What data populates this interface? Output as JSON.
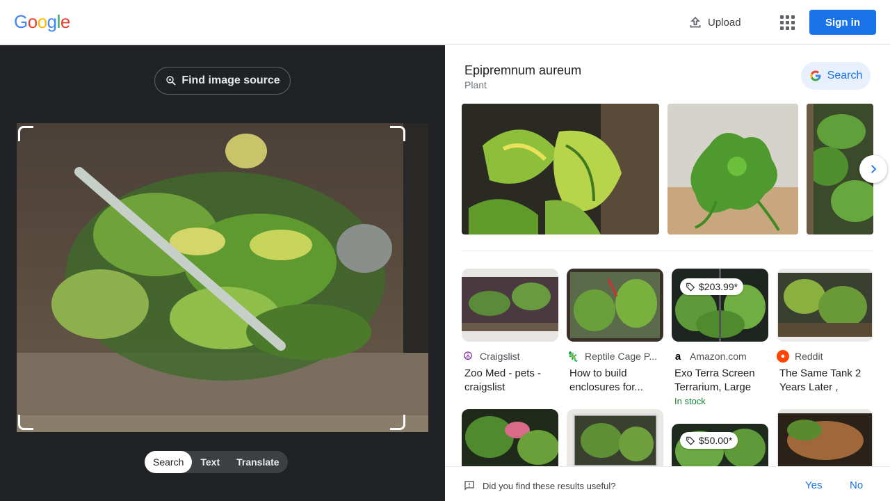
{
  "header": {
    "logo_letters": [
      "G",
      "o",
      "o",
      "g",
      "l",
      "e"
    ],
    "upload_label": "Upload",
    "sign_in_label": "Sign in",
    "apps_icon": "apps-grid-icon"
  },
  "left_panel": {
    "find_source_label": "Find image source",
    "modes": [
      "Search",
      "Text",
      "Translate"
    ],
    "active_mode": "Search"
  },
  "entity": {
    "title": "Epipremnum aureum",
    "subtitle": "Plant",
    "search_label": "Search"
  },
  "results": [
    {
      "source": "Craigslist",
      "title": "Zoo Med - pets - craigslist",
      "price": "",
      "stock": ""
    },
    {
      "source": "Reptile Cage P...",
      "title": "How to build enclosures for...",
      "price": "",
      "stock": ""
    },
    {
      "source": "Amazon.com",
      "title": "Exo Terra Screen Terrarium, Large",
      "price": "$203.99*",
      "stock": "In stock"
    },
    {
      "source": "Reddit",
      "title": "The Same Tank 2 Years Later , back...",
      "price": "",
      "stock": ""
    }
  ],
  "row2_prices": [
    "",
    "",
    "$50.00*",
    ""
  ],
  "feedback": {
    "question": "Did you find these results useful?",
    "yes": "Yes",
    "no": "No"
  },
  "colors": {
    "accent": "#1a73e8",
    "dark_panel": "#202124",
    "in_stock": "#188038"
  }
}
